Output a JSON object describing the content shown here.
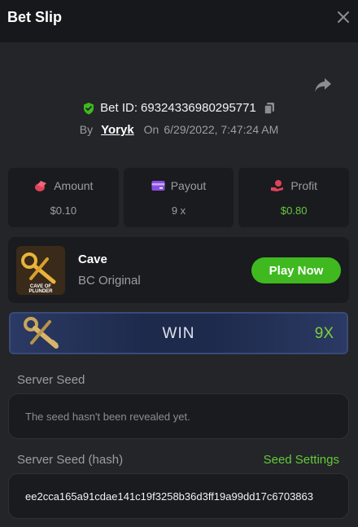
{
  "header": {
    "title": "Bet Slip"
  },
  "bet": {
    "id_label": "Bet ID:",
    "id": "69324336980295771",
    "by_label": "By",
    "user": "Yoryk",
    "on_label": "On",
    "date": "6/29/2022, 7:47:24 AM"
  },
  "stats": {
    "amount_label": "Amount",
    "amount": "$0.10",
    "payout_label": "Payout",
    "payout": "9 x",
    "profit_label": "Profit",
    "profit": "$0.80"
  },
  "game": {
    "name": "Cave",
    "category": "BC Original",
    "thumb_text": "CAVE OF PLUNDER",
    "play_label": "Play Now"
  },
  "result": {
    "label": "WIN",
    "multiplier": "9X"
  },
  "seeds": {
    "server_seed_label": "Server Seed",
    "server_seed_value": "The seed hasn't been revealed yet.",
    "hash_label": "Server Seed (hash)",
    "settings_link": "Seed Settings",
    "hash_value": "ee2cca165a91cdae141c19f3258b36d3ff19a99dd17c6703863"
  },
  "colors": {
    "accent_green": "#3fb91f",
    "profit_green": "#63c93b",
    "background": "#232528",
    "card": "#1a1b1e"
  }
}
